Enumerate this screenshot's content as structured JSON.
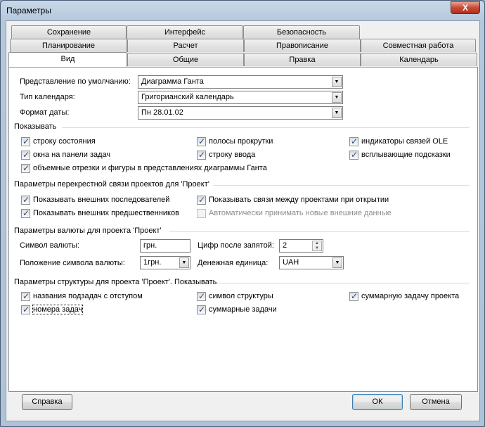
{
  "window": {
    "title": "Параметры",
    "close_label": "X"
  },
  "tabs": {
    "row1": [
      "Сохранение",
      "Интерфейс",
      "Безопасность"
    ],
    "row2": [
      "Планирование",
      "Расчет",
      "Правописание",
      "Совместная работа"
    ],
    "row3": [
      "Вид",
      "Общие",
      "Правка",
      "Календарь"
    ],
    "active": "Вид"
  },
  "view": {
    "default_view_label": "Представление по умолчанию:",
    "default_view_value": "Диаграмма Ганта",
    "calendar_type_label": "Тип календаря:",
    "calendar_type_value": "Григорианский календарь",
    "date_format_label": "Формат даты:",
    "date_format_value": "Пн 28.01.02"
  },
  "show": {
    "title": "Показывать",
    "items": [
      {
        "label": "строку состояния",
        "checked": true
      },
      {
        "label": "окна на панели задач",
        "checked": true
      },
      {
        "label": "объемные отрезки и фигуры в представлениях диаграммы Ганта",
        "checked": true
      },
      {
        "label": "полосы прокрутки",
        "checked": true
      },
      {
        "label": "строку ввода",
        "checked": true
      },
      {
        "label": "индикаторы связей OLE",
        "checked": true
      },
      {
        "label": "всплывающие подсказки",
        "checked": true
      }
    ]
  },
  "crossproject": {
    "title": "Параметры перекрестной связи проектов для 'Проект'",
    "items": [
      {
        "label": "Показывать внешних последователей",
        "checked": true
      },
      {
        "label": "Показывать внешних предшественников",
        "checked": true
      },
      {
        "label": "Показывать связи между проектами при открытии",
        "checked": true
      },
      {
        "label": "Автоматически принимать новые внешние данные",
        "checked": false
      }
    ]
  },
  "currency": {
    "title": "Параметры валюты для проекта 'Проект'",
    "symbol_label": "Символ валюты:",
    "symbol_value": "грн.",
    "digits_label": "Цифр после запятой:",
    "digits_value": "2",
    "position_label": "Положение символа валюты:",
    "position_value": "1грн.",
    "unit_label": "Денежная единица:",
    "unit_value": "UAH"
  },
  "outline": {
    "title": "Параметры структуры для проекта 'Проект'. Показывать",
    "items": [
      {
        "label": "названия подзадач с отступом",
        "checked": true
      },
      {
        "label": "номера задач",
        "checked": true
      },
      {
        "label": "символ структуры",
        "checked": true
      },
      {
        "label": "суммарные задачи",
        "checked": true
      },
      {
        "label": "суммарную задачу проекта",
        "checked": true
      }
    ]
  },
  "buttons": {
    "help": "Справка",
    "ok": "ОК",
    "cancel": "Отмена"
  }
}
